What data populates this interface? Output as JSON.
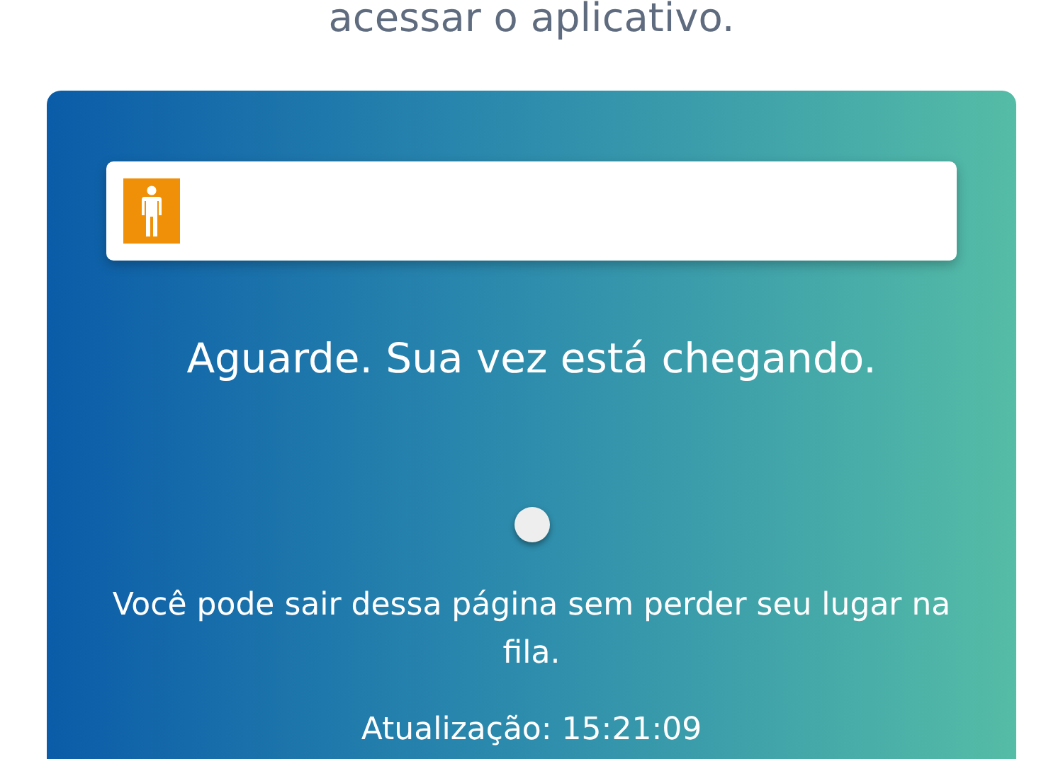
{
  "heading": "acessar o aplicativo.",
  "queue": {
    "progress": {
      "level": 0.07
    },
    "status": "Aguarde. Sua vez está chegando.",
    "notice": "Você pode sair dessa página sem perder seu lugar na fila.",
    "updated": "Atualização: 15:21:09"
  }
}
